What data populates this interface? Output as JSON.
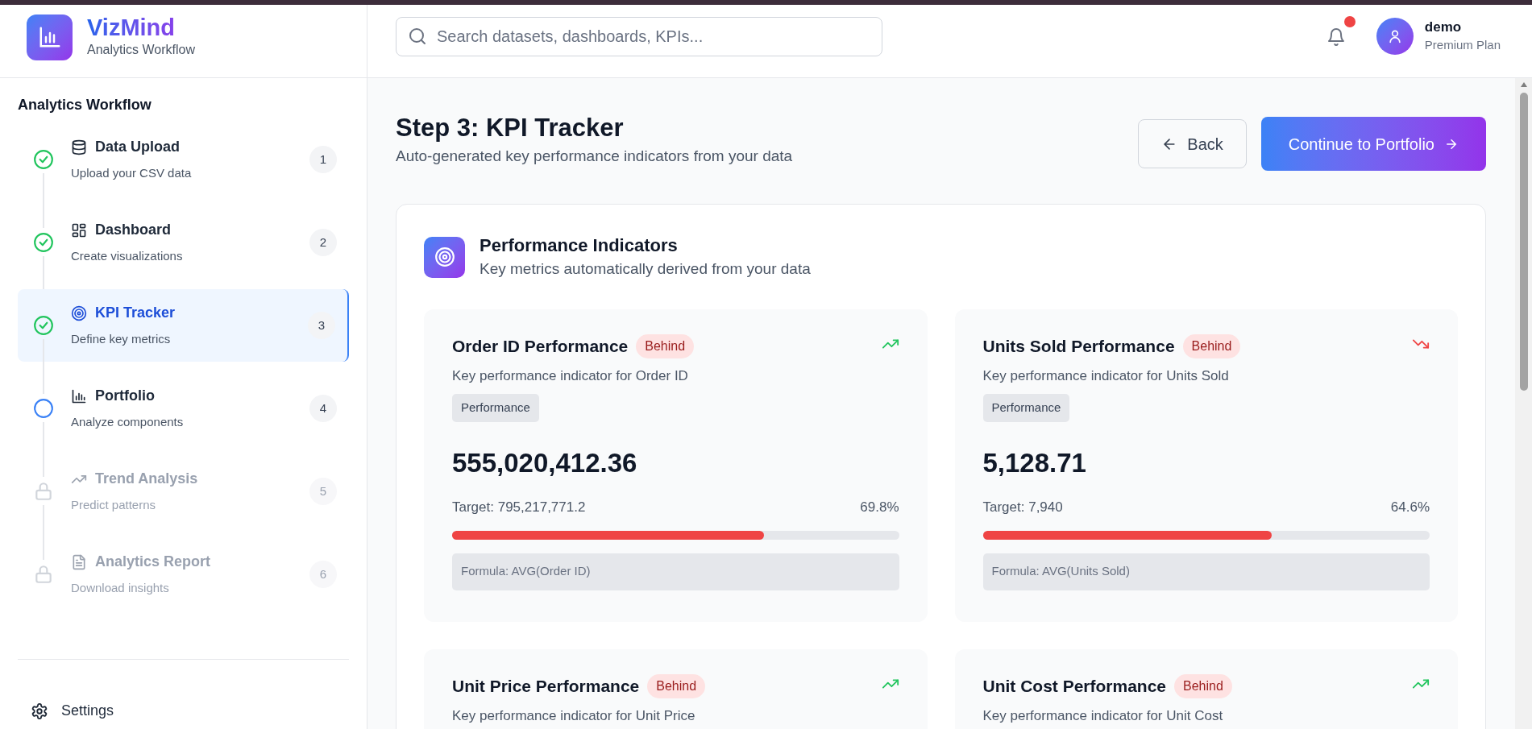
{
  "brand": {
    "name": "VizMind",
    "subtitle": "Analytics Workflow"
  },
  "sidebar": {
    "heading": "Analytics Workflow",
    "steps": [
      {
        "title": "Data Upload",
        "subtitle": "Upload your CSV data",
        "number": "1",
        "completed": true,
        "locked": false,
        "selected": false
      },
      {
        "title": "Dashboard",
        "subtitle": "Create visualizations",
        "number": "2",
        "completed": true,
        "locked": false,
        "selected": false
      },
      {
        "title": "KPI Tracker",
        "subtitle": "Define key metrics",
        "number": "3",
        "completed": true,
        "locked": false,
        "selected": true
      },
      {
        "title": "Portfolio",
        "subtitle": "Analyze components",
        "number": "4",
        "completed": false,
        "locked": false,
        "selected": false
      },
      {
        "title": "Trend Analysis",
        "subtitle": "Predict patterns",
        "number": "5",
        "completed": false,
        "locked": true,
        "selected": false
      },
      {
        "title": "Analytics Report",
        "subtitle": "Download insights",
        "number": "6",
        "completed": false,
        "locked": true,
        "selected": false
      }
    ],
    "settings": "Settings"
  },
  "search": {
    "placeholder": "Search datasets, dashboards, KPIs..."
  },
  "notifications": {
    "unread": true
  },
  "user": {
    "name": "demo",
    "plan": "Premium Plan"
  },
  "page": {
    "title": "Step 3: KPI Tracker",
    "subtitle": "Auto-generated key performance indicators from your data",
    "back_button": "Back",
    "continue_button": "Continue to Portfolio"
  },
  "panel": {
    "title": "Performance Indicators",
    "subtitle": "Key metrics automatically derived from your data",
    "kpis": [
      {
        "title": "Order ID Performance",
        "status": "Behind",
        "rising": true,
        "description": "Key performance indicator for Order ID",
        "tag": "Performance",
        "value": "555,020,412.36",
        "target": "Target: 795,217,771.2",
        "percent": "69.8%",
        "level": 0.698,
        "formula": "Formula: AVG(Order ID)"
      },
      {
        "title": "Units Sold Performance",
        "status": "Behind",
        "rising": false,
        "description": "Key performance indicator for Units Sold",
        "tag": "Performance",
        "value": "5,128.71",
        "target": "Target: 7,940",
        "percent": "64.6%",
        "level": 0.646,
        "formula": "Formula: AVG(Units Sold)"
      },
      {
        "title": "Unit Price Performance",
        "status": "Behind",
        "rising": true,
        "description": "Key performance indicator for Unit Price"
      },
      {
        "title": "Unit Cost Performance",
        "status": "Behind",
        "rising": true,
        "description": "Key performance indicator for Unit Cost"
      }
    ]
  }
}
